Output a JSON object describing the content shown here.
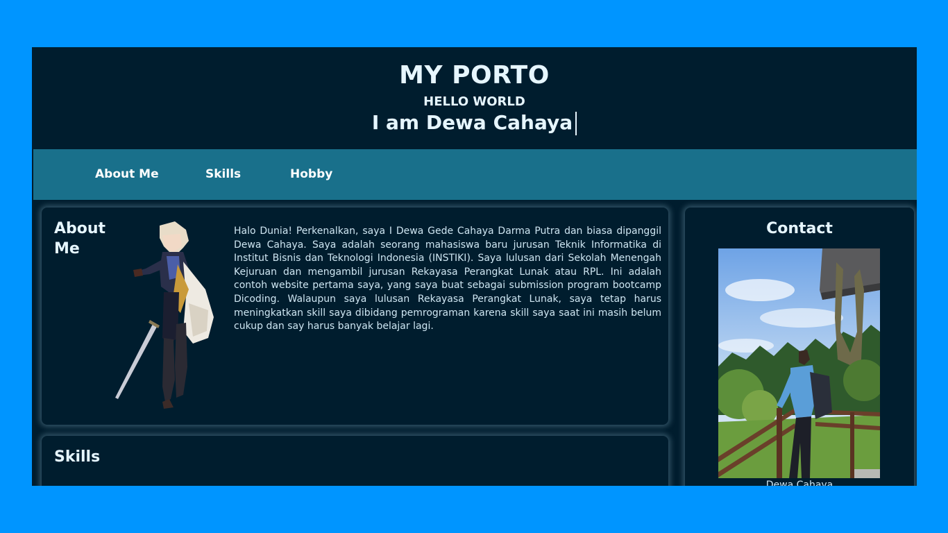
{
  "header": {
    "title": "MY PORTO",
    "subtitle": "HELLO WORLD",
    "typed_text": "I am Dewa Cahaya"
  },
  "nav": {
    "items": [
      "About Me",
      "Skills",
      "Hobby"
    ]
  },
  "about": {
    "title": "About Me",
    "text": "Halo Dunia! Perkenalkan, saya I Dewa Gede Cahaya Darma Putra dan biasa dipanggil Dewa Cahaya. Saya adalah seorang mahasiswa baru jurusan Teknik Informatika di Institut Bisnis dan Teknologi Indonesia (INSTIKI). Saya lulusan dari Sekolah Menengah Kejuruan dan mengambil jurusan Rekayasa Perangkat Lunak atau RPL. Ini adalah contoh website pertama saya, yang saya buat sebagai submission program bootcamp Dicoding. Walaupun saya lulusan Rekayasa Perangkat Lunak, saya tetap harus meningkatkan skill saya dibidang pemrograman karena skill saya saat ini masih belum cukup dan say harus banyak belajar lagi."
  },
  "skills": {
    "title": "Skills"
  },
  "contact": {
    "title": "Contact",
    "caption": "Dewa Cahaya"
  },
  "colors": {
    "page_bg": "#0095ff",
    "header_bg": "#001d2e",
    "nav_bg": "#19708b",
    "text": "#e6f6ff"
  }
}
